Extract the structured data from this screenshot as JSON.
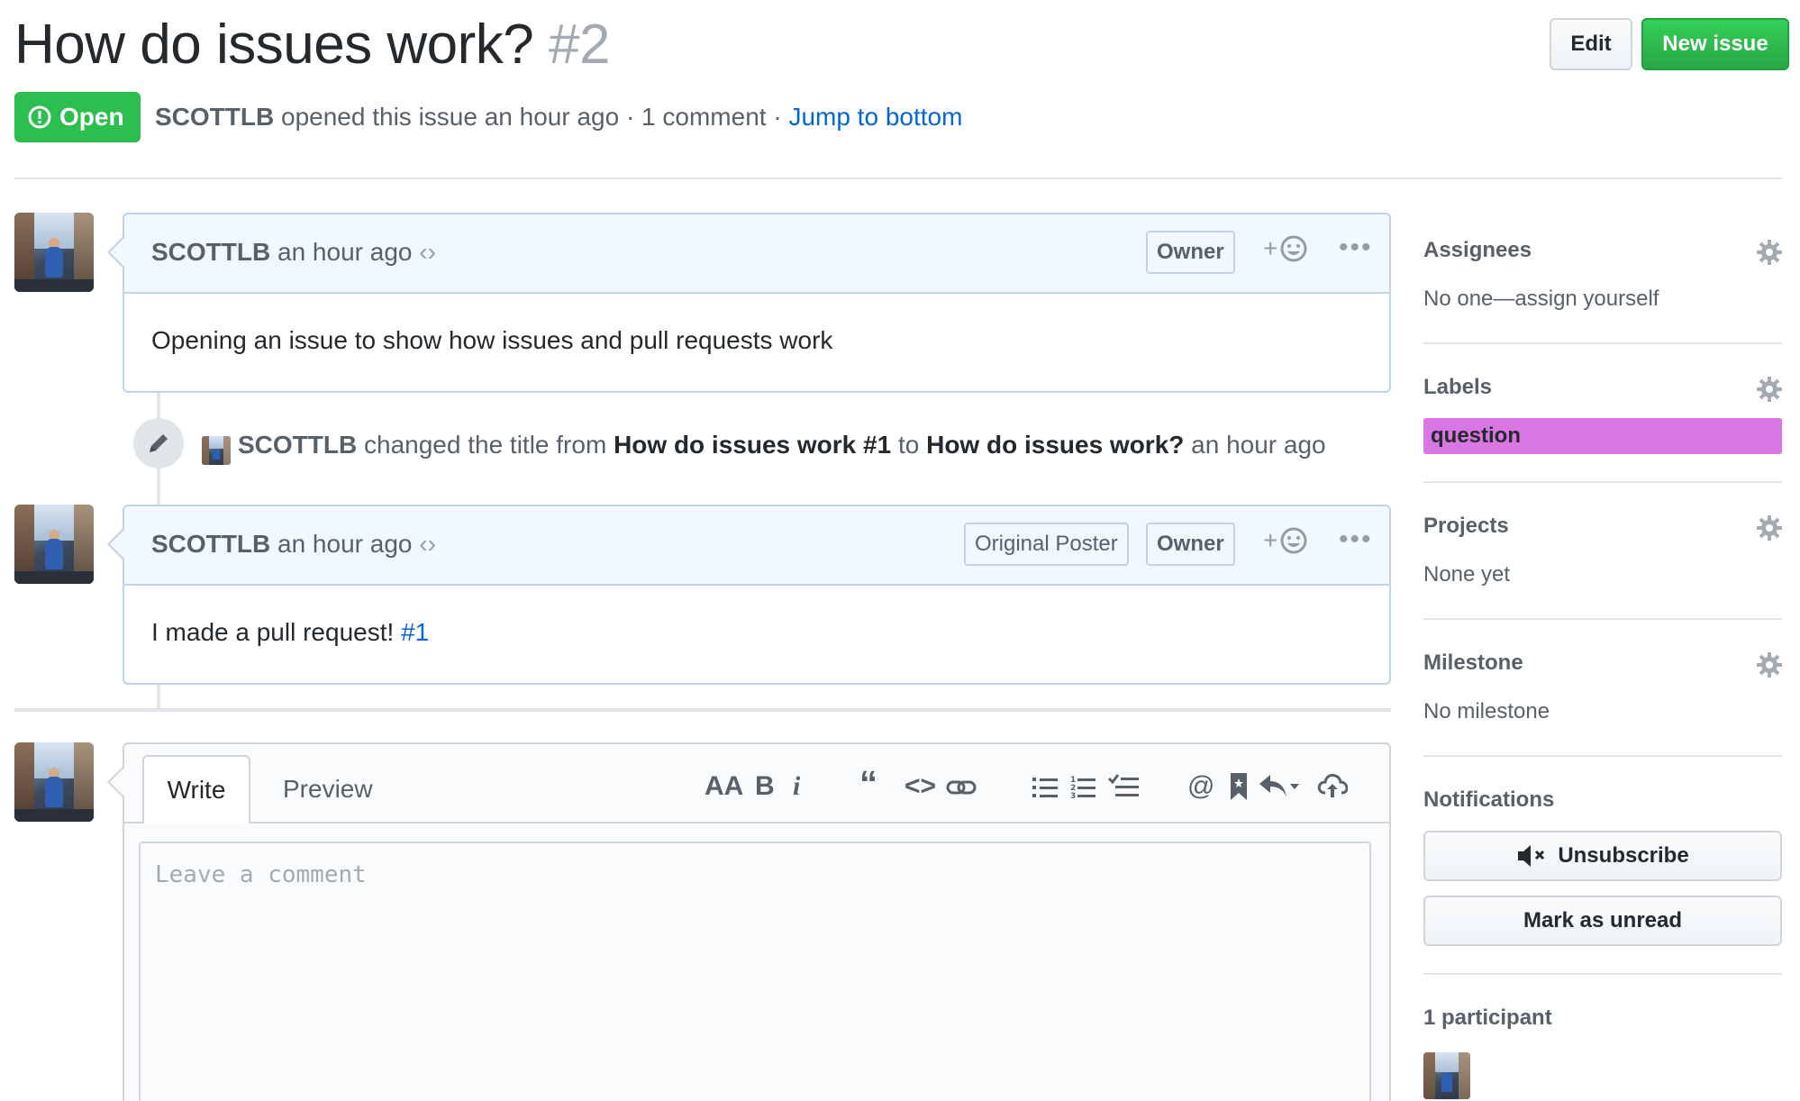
{
  "issue": {
    "title": "How do issues work?",
    "number": "#2",
    "state": "Open",
    "author": "SCOTTLB",
    "opened_text": "opened this issue an hour ago",
    "comment_count": "· 1 comment ·",
    "jump_link": "Jump to bottom"
  },
  "header_buttons": {
    "edit": "Edit",
    "new_issue": "New issue"
  },
  "comments": [
    {
      "author": "SCOTTLB",
      "time": "an hour ago",
      "badges": [
        "Owner"
      ],
      "body": "Opening an issue to show how issues and pull requests work"
    },
    {
      "author": "SCOTTLB",
      "time": "an hour ago",
      "badges": [
        "Original Poster",
        "Owner"
      ],
      "body": "I made a pull request!",
      "body_link": "#1"
    }
  ],
  "event": {
    "author": "SCOTTLB",
    "text1": "changed the title from",
    "old_title": "How do issues work #1",
    "text2": "to",
    "new_title": "How do issues work?",
    "time": "an hour ago"
  },
  "composer": {
    "tab_write": "Write",
    "tab_preview": "Preview",
    "placeholder": "Leave a comment"
  },
  "sidebar": {
    "assignees": {
      "title": "Assignees",
      "value": "No one—assign yourself"
    },
    "labels": {
      "title": "Labels",
      "items": [
        {
          "name": "question",
          "color": "#d876e3"
        }
      ]
    },
    "projects": {
      "title": "Projects",
      "value": "None yet"
    },
    "milestone": {
      "title": "Milestone",
      "value": "No milestone"
    },
    "notifications": {
      "title": "Notifications",
      "unsubscribe": "Unsubscribe",
      "mark_unread": "Mark as unread"
    },
    "participants": {
      "title": "1 participant"
    }
  },
  "colors": {
    "open_green": "#2cbe4e",
    "link_blue": "#0366d6",
    "label_question": "#d876e3"
  }
}
